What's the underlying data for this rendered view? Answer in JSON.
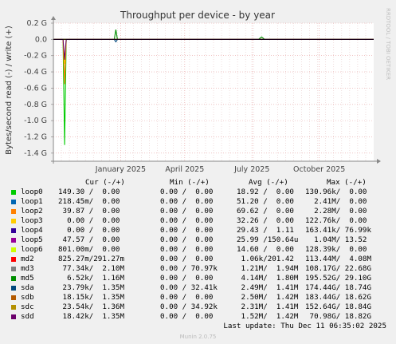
{
  "chart_data": {
    "type": "line",
    "title": "Throughput per device - by year",
    "ylabel": "Bytes/second read (-) / write (+)",
    "watermark": "RRDTOOL / TOBI OETIKER",
    "ylim": [
      -1.5,
      0.2
    ],
    "yticks": [
      {
        "v": 0.2,
        "label": "0.2 G"
      },
      {
        "v": 0.0,
        "label": "0.0"
      },
      {
        "v": -0.2,
        "label": "-0.2 G"
      },
      {
        "v": -0.4,
        "label": "-0.4 G"
      },
      {
        "v": -0.6,
        "label": "-0.6 G"
      },
      {
        "v": -0.8,
        "label": "-0.8 G"
      },
      {
        "v": -1.0,
        "label": "-1.0 G"
      },
      {
        "v": -1.2,
        "label": "-1.2 G"
      },
      {
        "v": -1.4,
        "label": "-1.4 G"
      }
    ],
    "xrange": [
      0,
      100
    ],
    "xticks": [
      {
        "x": 21,
        "label": "January 2025"
      },
      {
        "x": 41,
        "label": "April 2025"
      },
      {
        "x": 62,
        "label": "July 2025"
      },
      {
        "x": 83,
        "label": "October 2025"
      }
    ],
    "grid": true,
    "series": [
      {
        "name": "loop0",
        "color": "#00cc00",
        "points": [
          [
            0,
            0
          ],
          [
            3,
            0
          ],
          [
            3.5,
            -1.3
          ],
          [
            4,
            0
          ],
          [
            100,
            0
          ]
        ]
      },
      {
        "name": "loop1",
        "color": "#0066b3",
        "points": [
          [
            0,
            0
          ],
          [
            100,
            0
          ]
        ]
      },
      {
        "name": "loop2",
        "color": "#ff8000",
        "points": [
          [
            0,
            0
          ],
          [
            3,
            0
          ],
          [
            3.5,
            -0.55
          ],
          [
            4,
            0
          ],
          [
            100,
            0
          ]
        ]
      },
      {
        "name": "loop3",
        "color": "#ffcc00",
        "points": [
          [
            0,
            0
          ],
          [
            3,
            0
          ],
          [
            3.5,
            -0.3
          ],
          [
            4,
            0
          ],
          [
            100,
            0
          ]
        ]
      },
      {
        "name": "loop4",
        "color": "#330099",
        "points": [
          [
            0,
            0
          ],
          [
            100,
            0
          ]
        ]
      },
      {
        "name": "loop5",
        "color": "#990099",
        "points": [
          [
            0,
            0
          ],
          [
            100,
            0
          ]
        ]
      },
      {
        "name": "loop6",
        "color": "#ccff00",
        "points": [
          [
            0,
            0
          ],
          [
            100,
            0
          ]
        ]
      },
      {
        "name": "md2",
        "color": "#ff0000",
        "points": [
          [
            0,
            0
          ],
          [
            100,
            0
          ]
        ]
      },
      {
        "name": "md3",
        "color": "#808080",
        "points": [
          [
            0,
            0
          ],
          [
            100,
            0
          ]
        ]
      },
      {
        "name": "md5",
        "color": "#008f00",
        "points": [
          [
            0,
            0
          ],
          [
            19,
            0
          ],
          [
            19.5,
            0.12
          ],
          [
            20,
            0
          ],
          [
            64,
            0
          ],
          [
            65,
            0.03
          ],
          [
            66,
            0
          ],
          [
            100,
            0
          ]
        ]
      },
      {
        "name": "sda",
        "color": "#00487d",
        "points": [
          [
            0,
            0
          ],
          [
            19,
            0
          ],
          [
            19.5,
            -0.03
          ],
          [
            20,
            0
          ],
          [
            100,
            0
          ]
        ]
      },
      {
        "name": "sdb",
        "color": "#b35a00",
        "points": [
          [
            0,
            0
          ],
          [
            100,
            0
          ]
        ]
      },
      {
        "name": "sdc",
        "color": "#b38f00",
        "points": [
          [
            0,
            0
          ],
          [
            100,
            0
          ]
        ]
      },
      {
        "name": "sdd",
        "color": "#6b006b",
        "points": [
          [
            0,
            0
          ],
          [
            3,
            0
          ],
          [
            3.5,
            -0.25
          ],
          [
            4,
            0
          ],
          [
            100,
            0
          ]
        ]
      }
    ]
  },
  "legend": {
    "headers": {
      "cur": "Cur (-/+)",
      "min": "Min (-/+)",
      "avg": "Avg (-/+)",
      "max": "Max (-/+)"
    },
    "rows": [
      {
        "name": "loop0",
        "color": "#00cc00",
        "cur": "149.30 /  0.00",
        "min": "0.00 /  0.00",
        "avg": "18.92 /  0.00",
        "max": "130.96k/  0.00"
      },
      {
        "name": "loop1",
        "color": "#0066b3",
        "cur": "218.45m/  0.00",
        "min": "0.00 /  0.00",
        "avg": "51.20 /  0.00",
        "max": "  2.41M/  0.00"
      },
      {
        "name": "loop2",
        "color": "#ff8000",
        "cur": " 39.87 /  0.00",
        "min": "0.00 /  0.00",
        "avg": "69.62 /  0.00",
        "max": "  2.28M/  0.00"
      },
      {
        "name": "loop3",
        "color": "#ffcc00",
        "cur": "  0.00 /  0.00",
        "min": "0.00 /  0.00",
        "avg": "32.26 /  0.00",
        "max": "122.76k/  0.00"
      },
      {
        "name": "loop4",
        "color": "#330099",
        "cur": "  0.00 /  0.00",
        "min": "0.00 /  0.00",
        "avg": "29.43 /  1.11",
        "max": "163.41k/ 76.99k"
      },
      {
        "name": "loop5",
        "color": "#990099",
        "cur": " 47.57 /  0.00",
        "min": "0.00 /  0.00",
        "avg": "25.99 /150.64u",
        "max": "  1.04M/ 13.52"
      },
      {
        "name": "loop6",
        "color": "#ccff00",
        "cur": "801.00m/  0.00",
        "min": "0.00 /  0.00",
        "avg": "14.60 /  0.00",
        "max": "128.39k/  0.00"
      },
      {
        "name": "md2",
        "color": "#ff0000",
        "cur": "825.27m/291.27m",
        "min": "0.00 /  0.00",
        "avg": " 1.06k/201.42",
        "max": "113.44M/  4.08M"
      },
      {
        "name": "md3",
        "color": "#808080",
        "cur": " 77.34k/  2.10M",
        "min": "0.00 / 70.97k",
        "avg": " 1.21M/  1.94M",
        "max": "108.17G/ 22.68G"
      },
      {
        "name": "md5",
        "color": "#008f00",
        "cur": "  6.52k/  1.16M",
        "min": "0.00 /  0.00",
        "avg": " 4.14M/  1.80M",
        "max": "195.52G/ 29.10G"
      },
      {
        "name": "sda",
        "color": "#00487d",
        "cur": " 23.79k/  1.35M",
        "min": "0.00 / 32.41k",
        "avg": " 2.49M/  1.41M",
        "max": "174.44G/ 18.74G"
      },
      {
        "name": "sdb",
        "color": "#b35a00",
        "cur": " 18.15k/  1.35M",
        "min": "0.00 /  0.00",
        "avg": " 2.50M/  1.42M",
        "max": "183.44G/ 18.62G"
      },
      {
        "name": "sdc",
        "color": "#b38f00",
        "cur": " 23.54k/  1.36M",
        "min": "0.00 / 34.92k",
        "avg": " 2.31M/  1.41M",
        "max": "152.64G/ 18.84G"
      },
      {
        "name": "sdd",
        "color": "#6b006b",
        "cur": " 18.42k/  1.35M",
        "min": "0.00 /  0.00",
        "avg": " 1.52M/  1.42M",
        "max": " 70.98G/ 18.82G"
      }
    ]
  },
  "footer": {
    "last_update": "Last update: Thu Dec 11 06:35:02 2025",
    "munin": "Munin 2.0.75"
  }
}
